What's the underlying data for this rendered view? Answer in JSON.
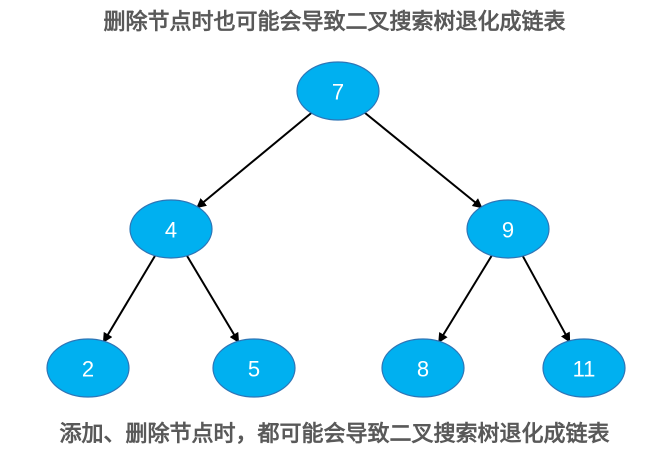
{
  "diagram": {
    "top_caption": "删除节点时也可能会导致二叉搜索树退化成链表",
    "bottom_caption": "添加、删除节点时，都可能会导致二叉搜索树退化成链表",
    "colors": {
      "node_fill": "#00b0f0",
      "node_stroke": "#2e75b6",
      "node_text": "#ffffff",
      "edge": "#000000",
      "caption_text": "#595959"
    },
    "nodes": [
      {
        "id": "n7",
        "label": "7"
      },
      {
        "id": "n4",
        "label": "4"
      },
      {
        "id": "n9",
        "label": "9"
      },
      {
        "id": "n2",
        "label": "2"
      },
      {
        "id": "n5",
        "label": "5"
      },
      {
        "id": "n8",
        "label": "8"
      },
      {
        "id": "n11",
        "label": "11"
      }
    ],
    "edges": [
      {
        "from": "n7",
        "to": "n4"
      },
      {
        "from": "n7",
        "to": "n9"
      },
      {
        "from": "n4",
        "to": "n2"
      },
      {
        "from": "n4",
        "to": "n5"
      },
      {
        "from": "n9",
        "to": "n8"
      },
      {
        "from": "n9",
        "to": "n11"
      }
    ]
  }
}
